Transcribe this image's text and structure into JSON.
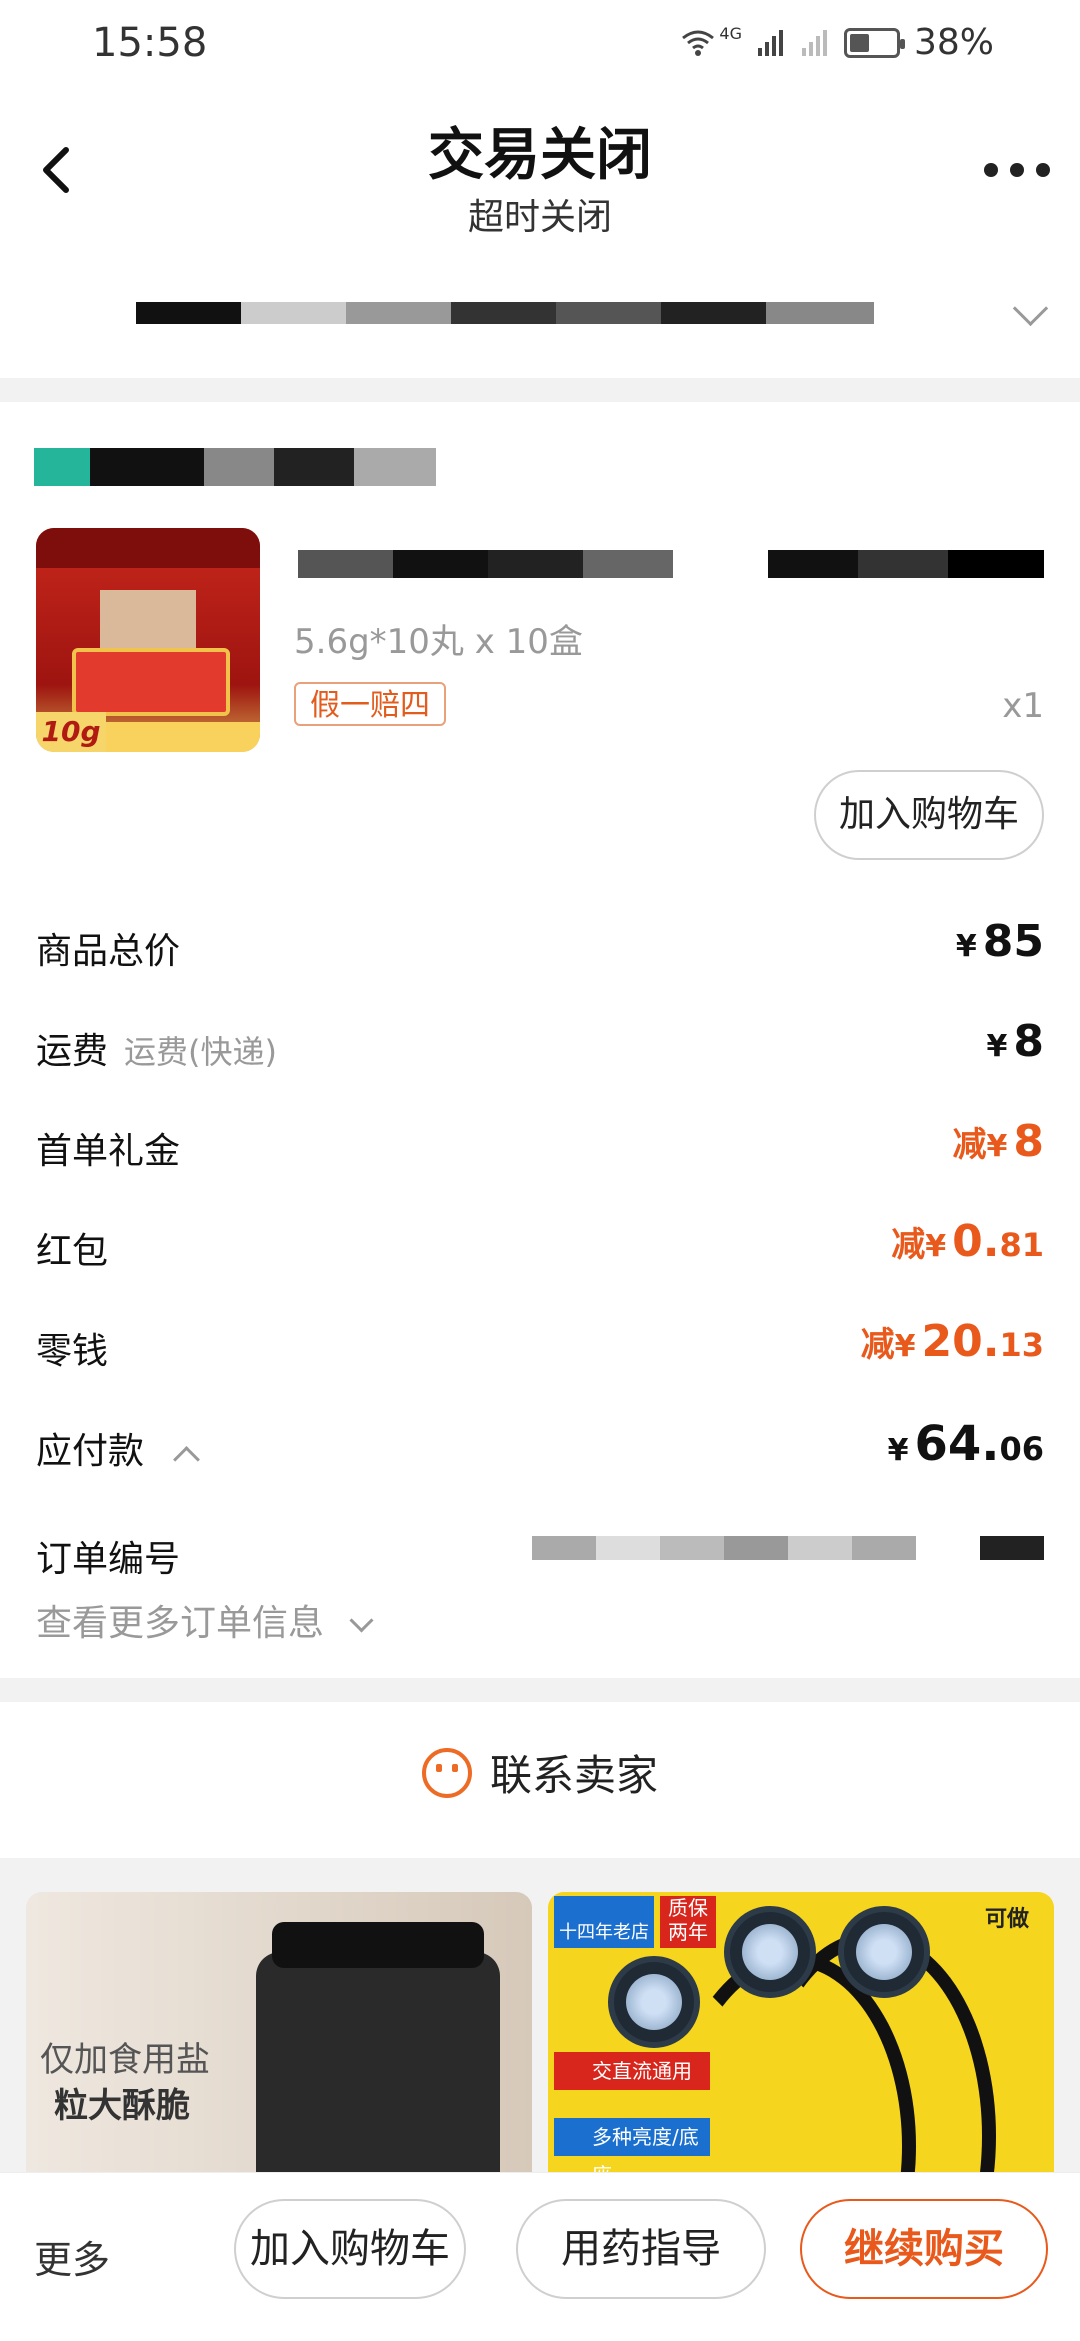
{
  "status_bar": {
    "time": "15:58",
    "network": "4G",
    "battery": "38%"
  },
  "nav": {
    "title": "交易关闭",
    "subtitle": "超时关闭"
  },
  "product": {
    "variant": "5.6g*10丸 x 10盒",
    "tag": "假一赔四",
    "qty": "x1",
    "add_cart": "加入购物车",
    "image_badge": "10g"
  },
  "price_rows": [
    {
      "label": "商品总价",
      "sub": "",
      "yen": "¥",
      "amount_int": "85",
      "amount_dec": "",
      "prefix": ""
    },
    {
      "label": "运费",
      "sub": "运费(快递)",
      "yen": "¥",
      "amount_int": "8",
      "amount_dec": "",
      "prefix": ""
    },
    {
      "label": "首单礼金",
      "sub": "",
      "yen": "¥",
      "amount_int": "8",
      "amount_dec": "",
      "prefix": "减"
    },
    {
      "label": "红包",
      "sub": "",
      "yen": "¥",
      "amount_int": "0.",
      "amount_dec": "81",
      "prefix": "减"
    },
    {
      "label": "零钱",
      "sub": "",
      "yen": "¥",
      "amount_int": "20.",
      "amount_dec": "13",
      "prefix": "减"
    },
    {
      "label": "应付款",
      "sub": "",
      "yen": "¥",
      "amount_int": "64.",
      "amount_dec": "06",
      "prefix": ""
    }
  ],
  "order": {
    "label": "订单编号",
    "more_info": "查看更多订单信息"
  },
  "contact": {
    "label": "联系卖家"
  },
  "recommendations": [
    {
      "line1": "仅加食用盐",
      "line2": "粒大酥脆"
    },
    {
      "header_left": "十四年老店",
      "header_mid": "质保两年",
      "header_right": "可做",
      "feature1": "交直流通用",
      "feature2": "多种亮度/底座"
    }
  ],
  "bottom_bar": {
    "more": "更多",
    "add_cart": "加入购物车",
    "guide": "用药指导",
    "buy": "继续购买"
  },
  "colors": {
    "accent": "#e8591b",
    "text": "#111111",
    "muted": "#999999"
  }
}
